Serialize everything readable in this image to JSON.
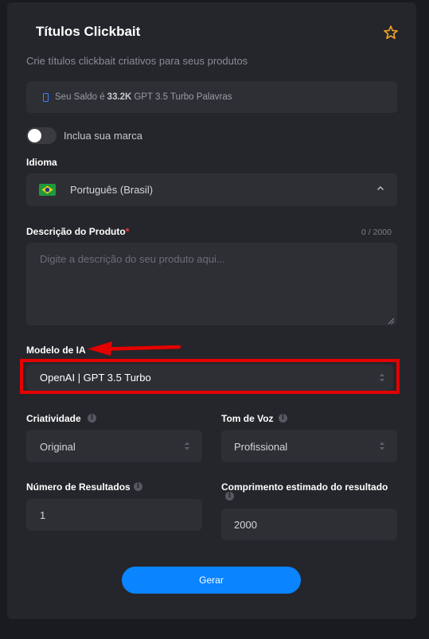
{
  "header": {
    "title": "Títulos Clickbait",
    "subtitle": "Crie títulos clickbait criativos para seus produtos"
  },
  "balance": {
    "prefix": "Seu Saldo é",
    "amount": "33.2K",
    "suffix": "GPT 3.5 Turbo Palavras"
  },
  "brand_toggle": {
    "label": "Inclua sua marca",
    "on": false
  },
  "language": {
    "label": "Idioma",
    "value": "Português (Brasil)"
  },
  "product_description": {
    "label": "Descrição do Produto",
    "required_mark": "*",
    "counter": "0 / 2000",
    "placeholder": "Digite a descrição do seu produto aqui..."
  },
  "ai_model": {
    "label": "Modelo de IA",
    "value": "OpenAI | GPT 3.5 Turbo"
  },
  "creativity": {
    "label": "Criatividade",
    "value": "Original"
  },
  "tone": {
    "label": "Tom de Voz",
    "value": "Profissional"
  },
  "num_results": {
    "label": "Número de Resultados",
    "value": "1"
  },
  "est_length": {
    "label": "Comprimento estimado do resultado",
    "value": "2000"
  },
  "submit": {
    "label": "Gerar"
  },
  "colors": {
    "accent": "#0a84ff",
    "annotation": "#e50000",
    "star": "#f5a623"
  },
  "icons": [
    "star-icon",
    "phone-icon",
    "brazil-flag-icon",
    "chevron-up-icon",
    "updown-chevron-icon",
    "info-icon",
    "resize-handle-icon",
    "annotation-arrow"
  ]
}
